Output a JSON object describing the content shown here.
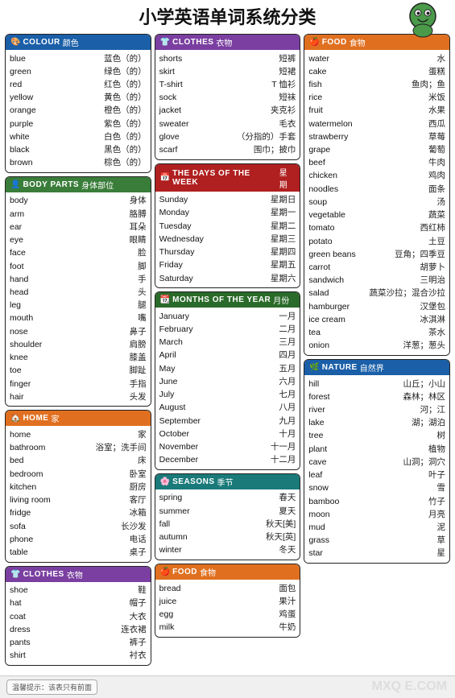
{
  "title": "小学英语单词系统分类",
  "sections": {
    "colour": {
      "header_en": "COLOUR",
      "header_zh": "颜色",
      "words": [
        {
          "en": "blue",
          "zh": "蓝色（的）"
        },
        {
          "en": "green",
          "zh": "绿色（的）"
        },
        {
          "en": "red",
          "zh": "红色（的）"
        },
        {
          "en": "yellow",
          "zh": "黄色（的）"
        },
        {
          "en": "orange",
          "zh": "橙色（的）"
        },
        {
          "en": "purple",
          "zh": "紫色（的）"
        },
        {
          "en": "white",
          "zh": "白色（的）"
        },
        {
          "en": "black",
          "zh": "黑色（的）"
        },
        {
          "en": "brown",
          "zh": "棕色（的）"
        }
      ]
    },
    "body_parts": {
      "header_en": "BODY PARTS",
      "header_zh": "身体部位",
      "words": [
        {
          "en": "body",
          "zh": "身体"
        },
        {
          "en": "arm",
          "zh": "胳膊"
        },
        {
          "en": "ear",
          "zh": "耳朵"
        },
        {
          "en": "eye",
          "zh": "眼睛"
        },
        {
          "en": "face",
          "zh": "脸"
        },
        {
          "en": "foot",
          "zh": "脚"
        },
        {
          "en": "hand",
          "zh": "手"
        },
        {
          "en": "head",
          "zh": "头"
        },
        {
          "en": "leg",
          "zh": "腿"
        },
        {
          "en": "mouth",
          "zh": "嘴"
        },
        {
          "en": "nose",
          "zh": "鼻子"
        },
        {
          "en": "shoulder",
          "zh": "肩膀"
        },
        {
          "en": "knee",
          "zh": "膝盖"
        },
        {
          "en": "toe",
          "zh": "脚趾"
        },
        {
          "en": "finger",
          "zh": "手指"
        },
        {
          "en": "hair",
          "zh": "头发"
        }
      ]
    },
    "home": {
      "header_en": "HOME",
      "header_zh": "家",
      "words": [
        {
          "en": "home",
          "zh": "家"
        },
        {
          "en": "bathroom",
          "zh": "浴室；洗手间"
        },
        {
          "en": "bed",
          "zh": "床"
        },
        {
          "en": "bedroom",
          "zh": "卧室"
        },
        {
          "en": "kitchen",
          "zh": "厨房"
        },
        {
          "en": "living room",
          "zh": "客厅"
        },
        {
          "en": "fridge",
          "zh": "冰箱"
        },
        {
          "en": "sofa",
          "zh": "长沙发"
        },
        {
          "en": "phone",
          "zh": "电话"
        },
        {
          "en": "table",
          "zh": "桌子"
        }
      ]
    },
    "clothes1": {
      "header_en": "CLOTHES",
      "header_zh": "衣物",
      "words": [
        {
          "en": "shoe",
          "zh": "鞋"
        },
        {
          "en": "hat",
          "zh": "帽子"
        },
        {
          "en": "coat",
          "zh": "大衣"
        },
        {
          "en": "dress",
          "zh": "连衣裙"
        },
        {
          "en": "pants",
          "zh": "裤子"
        },
        {
          "en": "shirt",
          "zh": "衬衣"
        }
      ]
    },
    "clothes2": {
      "header_en": "CLOTHES",
      "header_zh": "衣物",
      "words": [
        {
          "en": "shorts",
          "zh": "短裤"
        },
        {
          "en": "skirt",
          "zh": "短裙"
        },
        {
          "en": "T-shirt",
          "zh": "T 恤衫"
        },
        {
          "en": "sock",
          "zh": "短袜"
        },
        {
          "en": "jacket",
          "zh": "夹克衫"
        },
        {
          "en": "sweater",
          "zh": "毛衣"
        },
        {
          "en": "glove",
          "zh": "（分指的）手套"
        },
        {
          "en": "scarf",
          "zh": "围巾；披巾"
        }
      ]
    },
    "days": {
      "header_en": "THE DAYS OF THE WEEK",
      "header_zh": "星期",
      "words": [
        {
          "en": "Sunday",
          "zh": "星期日"
        },
        {
          "en": "Monday",
          "zh": "星期一"
        },
        {
          "en": "Tuesday",
          "zh": "星期二"
        },
        {
          "en": "Wednesday",
          "zh": "星期三"
        },
        {
          "en": "Thursday",
          "zh": "星期四"
        },
        {
          "en": "Friday",
          "zh": "星期五"
        },
        {
          "en": "Saturday",
          "zh": "星期六"
        }
      ]
    },
    "months": {
      "header_en": "MONTHS OF THE YEAR",
      "header_zh": "月份",
      "words": [
        {
          "en": "January",
          "zh": "一月"
        },
        {
          "en": "February",
          "zh": "二月"
        },
        {
          "en": "March",
          "zh": "三月"
        },
        {
          "en": "April",
          "zh": "四月"
        },
        {
          "en": "May",
          "zh": "五月"
        },
        {
          "en": "June",
          "zh": "六月"
        },
        {
          "en": "July",
          "zh": "七月"
        },
        {
          "en": "August",
          "zh": "八月"
        },
        {
          "en": "September",
          "zh": "九月"
        },
        {
          "en": "October",
          "zh": "十月"
        },
        {
          "en": "November",
          "zh": "十一月"
        },
        {
          "en": "December",
          "zh": "十二月"
        }
      ]
    },
    "seasons": {
      "header_en": "SEASONS",
      "header_zh": "季节",
      "words": [
        {
          "en": "spring",
          "zh": "春天"
        },
        {
          "en": "summer",
          "zh": "夏天"
        },
        {
          "en": "fall",
          "zh": "秋天[美]"
        },
        {
          "en": "autumn",
          "zh": "秋天[英]"
        },
        {
          "en": "winter",
          "zh": "冬天"
        }
      ]
    },
    "food1": {
      "header_en": "FOOD",
      "header_zh": "食物",
      "words": [
        {
          "en": "bread",
          "zh": "面包"
        },
        {
          "en": "juice",
          "zh": "果汁"
        },
        {
          "en": "egg",
          "zh": "鸡蛋"
        },
        {
          "en": "milk",
          "zh": "牛奶"
        }
      ]
    },
    "food2": {
      "header_en": "FOOD",
      "header_zh": "食物",
      "words": [
        {
          "en": "water",
          "zh": "水"
        },
        {
          "en": "cake",
          "zh": "蛋糕"
        },
        {
          "en": "fish",
          "zh": "鱼肉；鱼"
        },
        {
          "en": "rice",
          "zh": "米饭"
        },
        {
          "en": "fruit",
          "zh": "水果"
        },
        {
          "en": "watermelon",
          "zh": "西瓜"
        },
        {
          "en": "strawberry",
          "zh": "草莓"
        },
        {
          "en": "grape",
          "zh": "葡萄"
        },
        {
          "en": "beef",
          "zh": "牛肉"
        },
        {
          "en": "chicken",
          "zh": "鸡肉"
        },
        {
          "en": "noodles",
          "zh": "面条"
        },
        {
          "en": "soup",
          "zh": "汤"
        },
        {
          "en": "vegetable",
          "zh": "蔬菜"
        },
        {
          "en": "tomato",
          "zh": "西红柿"
        },
        {
          "en": "potato",
          "zh": "土豆"
        },
        {
          "en": "green beans",
          "zh": "豆角；四季豆"
        },
        {
          "en": "carrot",
          "zh": "胡萝卜"
        },
        {
          "en": "sandwich",
          "zh": "三明治"
        },
        {
          "en": "salad",
          "zh": "蔬菜沙拉；混合沙拉"
        },
        {
          "en": "hamburger",
          "zh": "汉堡包"
        },
        {
          "en": "ice cream",
          "zh": "冰淇淋"
        },
        {
          "en": "tea",
          "zh": "茶水"
        },
        {
          "en": "onion",
          "zh": "洋葱；葱头"
        }
      ]
    },
    "nature": {
      "header_en": "NATURE",
      "header_zh": "自然界",
      "words": [
        {
          "en": "hill",
          "zh": "山丘；小山"
        },
        {
          "en": "forest",
          "zh": "森林；林区"
        },
        {
          "en": "river",
          "zh": "河；江"
        },
        {
          "en": "lake",
          "zh": "湖；湖泊"
        },
        {
          "en": "tree",
          "zh": "树"
        },
        {
          "en": "plant",
          "zh": "植物"
        },
        {
          "en": "cave",
          "zh": "山洞；洞穴"
        },
        {
          "en": "leaf",
          "zh": "叶子"
        },
        {
          "en": "snow",
          "zh": "雪"
        },
        {
          "en": "bamboo",
          "zh": "竹子"
        },
        {
          "en": "moon",
          "zh": "月亮"
        },
        {
          "en": "mud",
          "zh": "泥"
        },
        {
          "en": "grass",
          "zh": "草"
        },
        {
          "en": "star",
          "zh": "星"
        }
      ]
    }
  },
  "footer": {
    "hint": "温馨提示：该表只有前面",
    "watermark": "MXQ E.COM"
  }
}
